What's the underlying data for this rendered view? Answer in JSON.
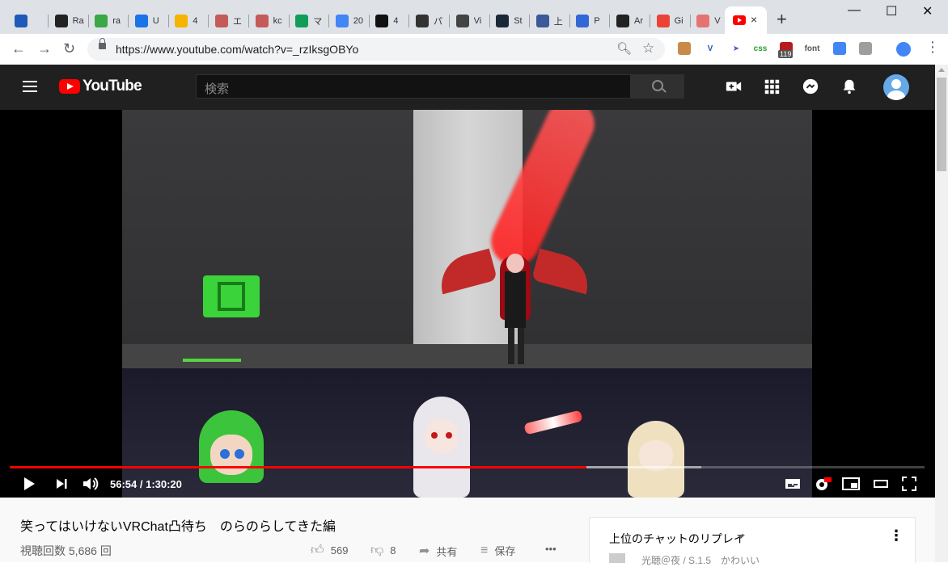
{
  "browser": {
    "tabs": [
      {
        "icon": "vivaldi-icon",
        "label": "",
        "color": "#1e5bb8"
      },
      {
        "icon": "github-icon",
        "label": "Ra",
        "color": "#222222"
      },
      {
        "icon": "green-ring-icon",
        "label": "ra",
        "color": "#39a845"
      },
      {
        "icon": "k-box-icon",
        "label": "U",
        "color": "#1a73e8"
      },
      {
        "icon": "drive-icon",
        "label": "4",
        "color": "#f4b400"
      },
      {
        "icon": "sakura-icon",
        "label": "エ",
        "color": "#c45a5a"
      },
      {
        "icon": "sakura-icon",
        "label": "kc",
        "color": "#c45a5a"
      },
      {
        "icon": "drive-icon",
        "label": "マ",
        "color": "#0f9d58"
      },
      {
        "icon": "docs-icon",
        "label": "20",
        "color": "#4285f4"
      },
      {
        "icon": "box-logo-icon",
        "label": "4",
        "color": "#111111"
      },
      {
        "icon": "pa-icon",
        "label": "パ",
        "color": "#333333"
      },
      {
        "icon": "vr-icon",
        "label": "Vi",
        "color": "#444444"
      },
      {
        "icon": "steam-icon",
        "label": "St",
        "color": "#1b2838"
      },
      {
        "icon": "d-circle-icon",
        "label": "上",
        "color": "#3b5998"
      },
      {
        "icon": "blue-banner-icon",
        "label": "P",
        "color": "#3367d6"
      },
      {
        "icon": "amazon-icon",
        "label": "Ar",
        "color": "#222222"
      },
      {
        "icon": "gmail-icon",
        "label": "Gi",
        "color": "#ea4335"
      },
      {
        "icon": "v-red-icon",
        "label": "V",
        "color": "#e57373"
      }
    ],
    "active_tab_close": "×",
    "new_tab": "+",
    "window_controls": {
      "minimize": "—",
      "maximize": "☐",
      "close": "✕"
    },
    "url": "https://www.youtube.com/watch?v=_rzIksgOBYo",
    "extensions": [
      {
        "icon": "chipmunk-icon",
        "label": "",
        "color": "#c88a4a"
      },
      {
        "icon": "vivaldi-ext-icon",
        "label": "V",
        "color": "#1e5bb8"
      },
      {
        "icon": "cursor-icon",
        "label": "➤",
        "color": "#7b3bd0"
      },
      {
        "icon": "css-icon",
        "label": "css",
        "color": "#2a9d2a"
      },
      {
        "icon": "ublock-icon",
        "label": "",
        "color": "#b71c1c"
      },
      {
        "icon": "font-icon",
        "label": "font",
        "color": "#555555"
      },
      {
        "icon": "chrome-icon",
        "label": "",
        "color": "#4285f4"
      },
      {
        "icon": "drive-ext-icon",
        "label": "",
        "color": "#9e9e9e"
      }
    ],
    "extension_badge": "119"
  },
  "youtube": {
    "logo_text": "YouTube",
    "search_placeholder": "検索",
    "video": {
      "current_time": "56:54 / 1:30:20",
      "played_fraction": 0.63,
      "buffered_fraction": 0.756
    },
    "title": "笑ってはいけないVRChat凸待ち　のらのらしてきた編",
    "views": "視聴回数 5,686 回",
    "likes": "569",
    "dislikes": "8",
    "share_label": "共有",
    "save_label": "保存",
    "more_label": "•••",
    "chat_header": "上位のチャットのリプレイ",
    "chat_preview": "光聴＠夜 / S.1.5　かわいい"
  },
  "colors": {
    "accent_red": "#ff0000",
    "masthead": "#202020"
  }
}
